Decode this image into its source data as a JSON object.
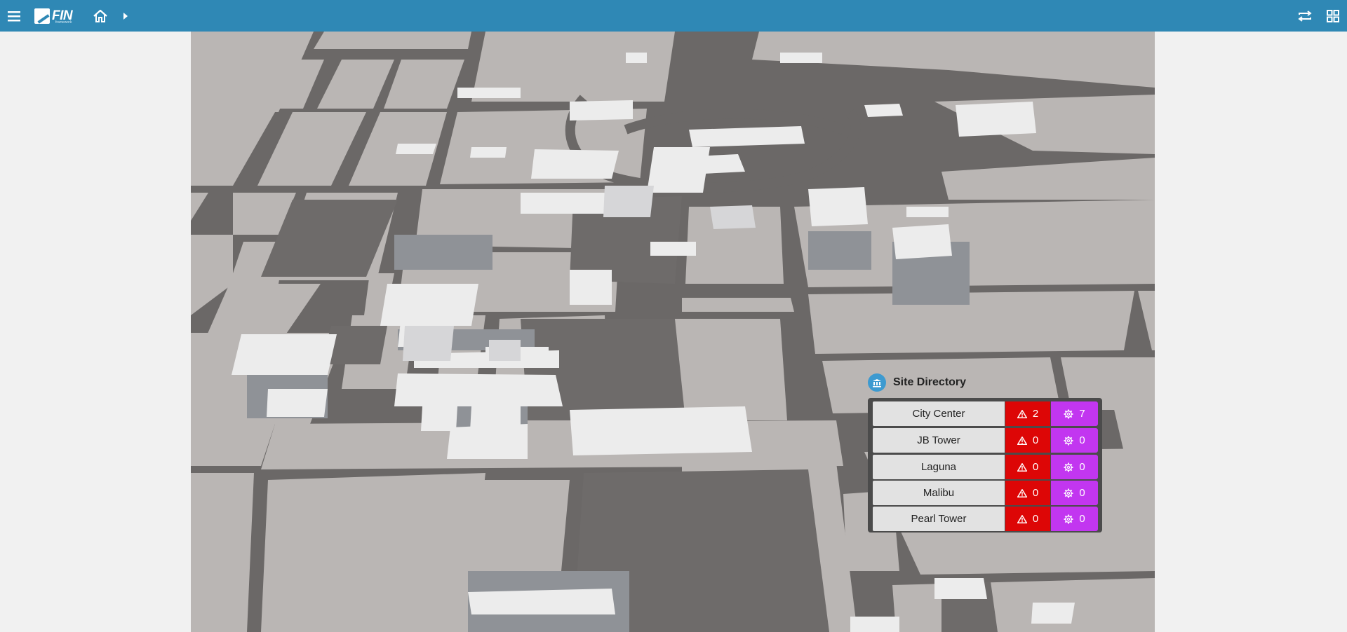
{
  "app": {
    "logo_text": "FIN",
    "logo_subtext": "framework"
  },
  "topbar": {
    "menu_icon": "hamburger-menu-icon",
    "home_icon": "home-icon",
    "nav_icon": "caret-right-icon",
    "refresh_icon": "sync-icon",
    "apps_icon": "grid-apps-icon",
    "background": "#2f88b5"
  },
  "site_directory": {
    "title": "Site Directory",
    "icon": "building-columns-icon",
    "sites": [
      {
        "name": "City Center",
        "alarms": "2",
        "sparks": "7"
      },
      {
        "name": "JB Tower",
        "alarms": "0",
        "sparks": "0"
      },
      {
        "name": "Laguna",
        "alarms": "0",
        "sparks": "0"
      },
      {
        "name": "Malibu",
        "alarms": "0",
        "sparks": "0"
      },
      {
        "name": "Pearl Tower",
        "alarms": "0",
        "sparks": "0"
      }
    ],
    "alarm_icon": "warning-triangle-icon",
    "spark_icon": "gear-icon",
    "colors": {
      "alarm": "#dd0606",
      "spark": "#c236f0",
      "panel": "#4b4b4b"
    }
  }
}
